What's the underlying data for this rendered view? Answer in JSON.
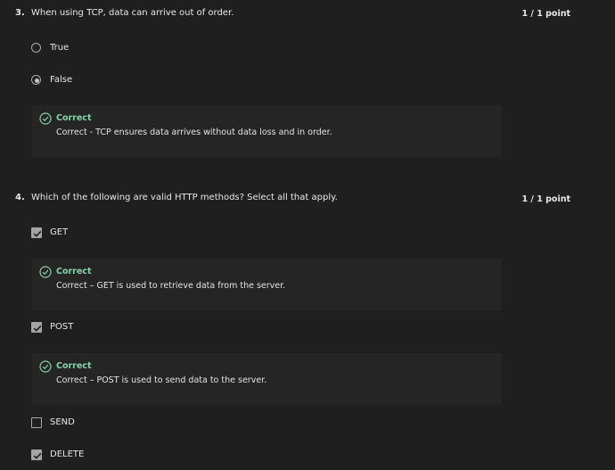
{
  "questions": [
    {
      "number": "3.",
      "text": "When using TCP, data can arrive out of order.",
      "points": "1 / 1 point",
      "options": [
        {
          "label": "True",
          "selected": false
        },
        {
          "label": "False",
          "selected": true
        }
      ],
      "feedback": {
        "title": "Correct",
        "text": "Correct - TCP ensures data arrives without data loss and in order."
      }
    },
    {
      "number": "4.",
      "text": "Which of the following are valid HTTP methods? Select all that apply.",
      "points": "1 / 1 point",
      "options": [
        {
          "label": "GET",
          "checked": true,
          "feedback": {
            "title": "Correct",
            "text": "Correct – GET is used to retrieve data from the server."
          }
        },
        {
          "label": "POST",
          "checked": true,
          "feedback": {
            "title": "Correct",
            "text": "Correct – POST is used to send data to the server."
          }
        },
        {
          "label": "SEND",
          "checked": false
        },
        {
          "label": "DELETE",
          "checked": true
        }
      ]
    }
  ],
  "icons": {
    "feedback_icon": "check-circle-icon",
    "checkbox_icon": "checkmark-icon"
  },
  "colors": {
    "background": "#1f1f1f",
    "feedback_bg": "#252525",
    "correct": "#86d4a8"
  }
}
